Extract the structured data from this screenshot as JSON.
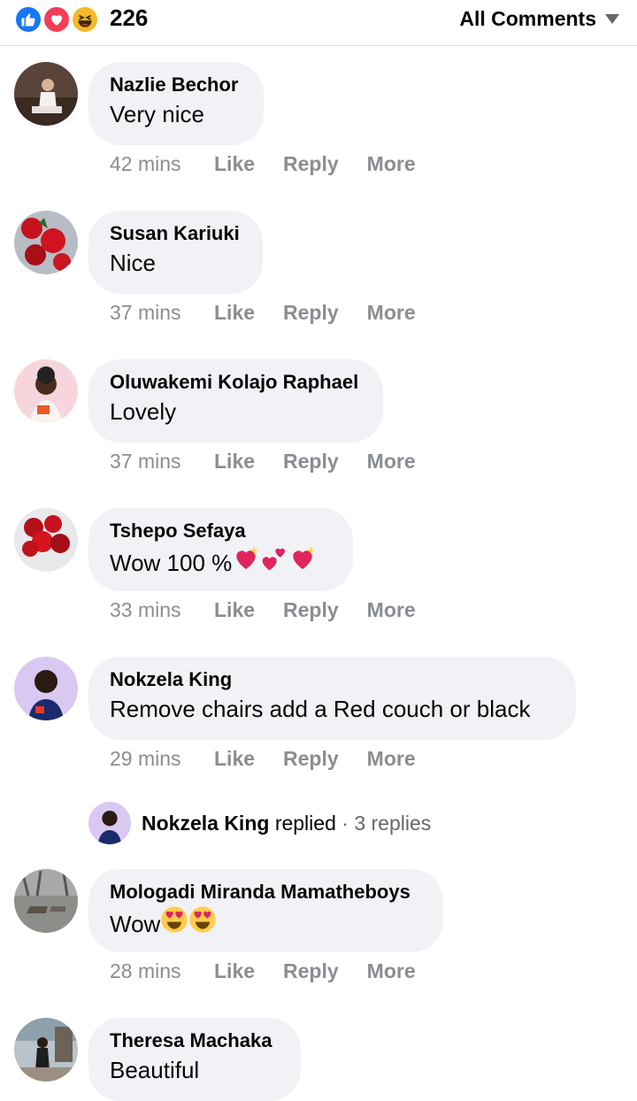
{
  "header": {
    "reaction_count": "226",
    "filter_label": "All Comments",
    "reaction_icons": [
      "like-icon",
      "love-icon",
      "haha-icon"
    ]
  },
  "comments": [
    {
      "author": "Nazlie Bechor",
      "text": "Very nice",
      "time": "42 mins",
      "like": "Like",
      "reply": "Reply",
      "more": "More"
    },
    {
      "author": "Susan Kariuki",
      "text": "Nice",
      "time": "37 mins",
      "like": "Like",
      "reply": "Reply",
      "more": "More"
    },
    {
      "author": "Oluwakemi Kolajo Raphael",
      "text": "Lovely",
      "time": "37 mins",
      "like": "Like",
      "reply": "Reply",
      "more": "More"
    },
    {
      "author": "Tshepo Sefaya",
      "text": "Wow 100 %",
      "emojis": [
        "sparkling-heart",
        "two-hearts",
        "sparkling-heart"
      ],
      "time": "33 mins",
      "like": "Like",
      "reply": "Reply",
      "more": "More"
    },
    {
      "author": "Nokzela King",
      "text": "Remove chairs add a Red couch or black",
      "time": "29 mins",
      "like": "Like",
      "reply": "Reply",
      "more": "More"
    },
    {
      "author": "Mologadi Miranda Mamatheboys",
      "text": "Wow",
      "emojis": [
        "heart-eyes",
        "heart-eyes"
      ],
      "time": "28 mins",
      "like": "Like",
      "reply": "Reply",
      "more": "More"
    },
    {
      "author": "Theresa Machaka",
      "text": "Beautiful"
    }
  ],
  "reply_thread": {
    "name": "Nokzela King",
    "action": "replied",
    "separator": "·",
    "count": "3 replies"
  },
  "colors": {
    "like_blue": "#1877f2",
    "love_red": "#f33e58",
    "haha_yellow": "#f7b928",
    "bubble_bg": "#f0f2f5",
    "meta_grey": "#8a8d91"
  }
}
